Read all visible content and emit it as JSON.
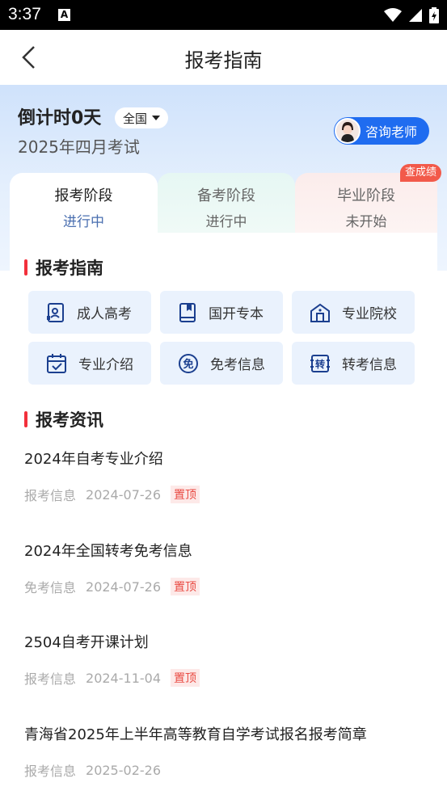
{
  "status_bar": {
    "time": "3:37"
  },
  "nav": {
    "title": "报考指南"
  },
  "hero": {
    "countdown": "倒计时0天",
    "region": "全国",
    "exam_month": "2025年四月考试",
    "consult_label": "咨询老师"
  },
  "tabs": [
    {
      "name": "报考阶段",
      "status": "进行中"
    },
    {
      "name": "备考阶段",
      "status": "进行中"
    },
    {
      "name": "毕业阶段",
      "status": "未开始"
    }
  ],
  "badge": "查成绩",
  "guide": {
    "title": "报考指南",
    "items": [
      {
        "label": "成人高考",
        "icon": "id-card-icon"
      },
      {
        "label": "国开专本",
        "icon": "book-icon"
      },
      {
        "label": "专业院校",
        "icon": "school-building-icon"
      },
      {
        "label": "专业介绍",
        "icon": "calendar-check-icon"
      },
      {
        "label": "免考信息",
        "icon": "exempt-circle-icon"
      },
      {
        "label": "转考信息",
        "icon": "transfer-icon"
      }
    ]
  },
  "news": {
    "title": "报考资讯",
    "items": [
      {
        "title": "2024年自考专业介绍",
        "category": "报考信息",
        "date": "2024-07-26",
        "tag": "置顶"
      },
      {
        "title": "2024年全国转考免考信息",
        "category": "免考信息",
        "date": "2024-07-26",
        "tag": "置顶"
      },
      {
        "title": "2504自考开课计划",
        "category": "报考信息",
        "date": "2024-11-04",
        "tag": "置顶"
      },
      {
        "title": "青海省2025年上半年高等教育自学考试报名报考简章",
        "category": "报考信息",
        "date": "2025-02-26",
        "tag": ""
      }
    ]
  },
  "colors": {
    "accent": "#1f6cf0",
    "section_bar": "#f2303b",
    "tile_bg": "#eaf2fd",
    "icon": "#1b3f8f"
  }
}
